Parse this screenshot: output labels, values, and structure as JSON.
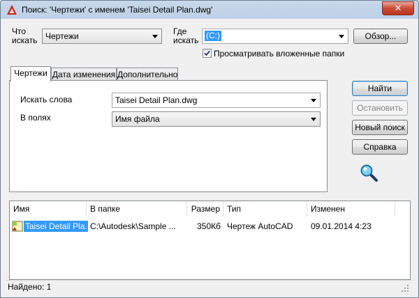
{
  "window": {
    "title": "Поиск: 'Чертежи' с именем 'Taisei Detail Plan.dwg'",
    "close_label": "✕"
  },
  "search": {
    "what_label_1": "Что",
    "what_label_2": "искать",
    "what_value": "Чертежи",
    "where_label_1": "Где",
    "where_label_2": "искать",
    "where_value": "(C:)",
    "browse_label": "Обзор...",
    "subfolders_label": "Просматривать вложенные папки",
    "subfolders_checked": true
  },
  "tabs": [
    {
      "label": "Чертежи",
      "active": true
    },
    {
      "label": "Дата изменения",
      "active": false
    },
    {
      "label": "Дополнительно",
      "active": false
    }
  ],
  "panel": {
    "words_label": "Искать слова",
    "words_value": "Taisei Detail Plan.dwg",
    "fields_label": "В полях",
    "fields_value": "Имя файла"
  },
  "actions": {
    "find": "Найти",
    "stop": "Остановить",
    "new_search": "Новый поиск",
    "help": "Справка"
  },
  "results": {
    "columns": [
      "Имя",
      "В папке",
      "Размер",
      "Тип",
      "Изменен"
    ],
    "rows": [
      {
        "name": "Taisei Detail Pla...",
        "folder": "C:\\Autodesk\\Sample ...",
        "size": "350Кб",
        "type": "Чертеж AutoCAD",
        "modified": "09.01.2014 4:23"
      }
    ]
  },
  "status": {
    "found": "Найдено: 1"
  },
  "colors": {
    "selection": "#3399ff",
    "app_icon": "#c8281e"
  }
}
